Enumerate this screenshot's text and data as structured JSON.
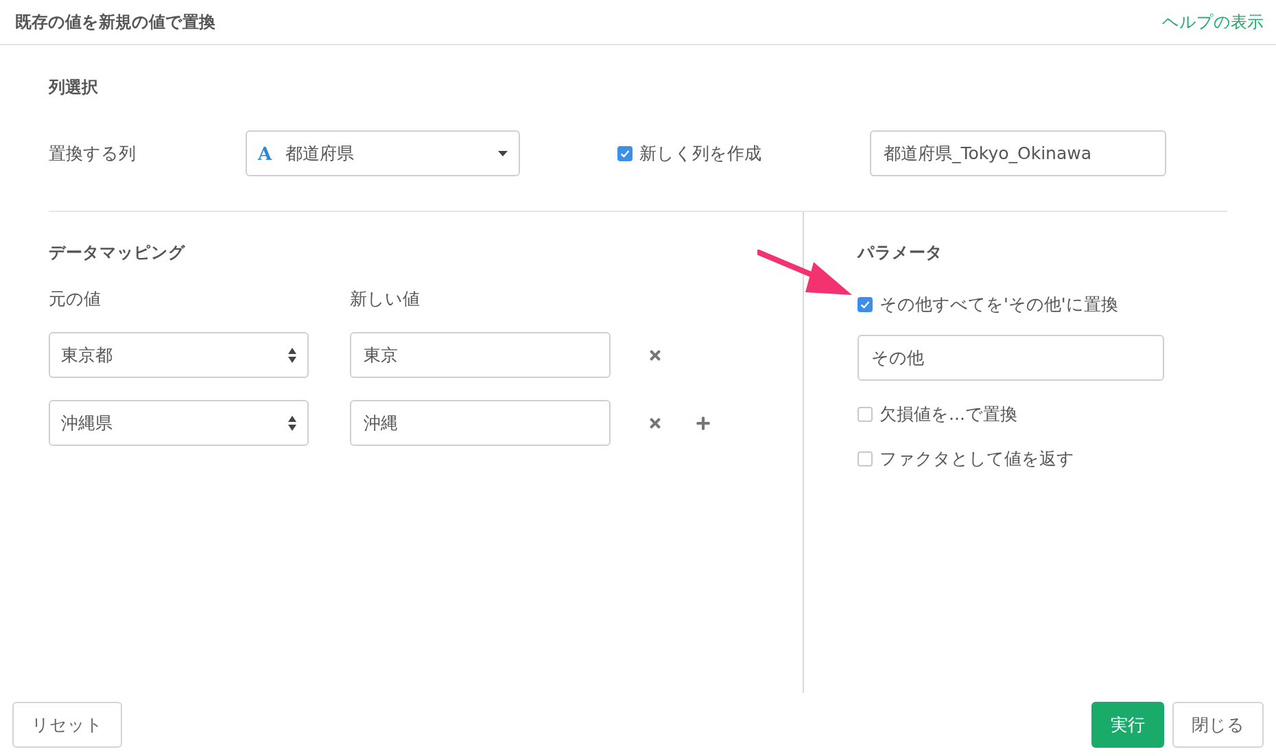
{
  "dialog": {
    "title": "既存の値を新規の値で置換",
    "help_link": "ヘルプの表示"
  },
  "column_selection": {
    "heading": "列選択",
    "label": "置換する列",
    "column_select": {
      "type_icon": "A",
      "value": "都道府県"
    },
    "new_column": {
      "label": "新しく列を作成",
      "checked": true
    },
    "new_column_name": {
      "value": "都道府県_Tokyo_Okinawa"
    }
  },
  "data_mapping": {
    "heading": "データマッピング",
    "original_label": "元の値",
    "new_label": "新しい値",
    "rows": [
      {
        "original": "東京都",
        "new": "東京"
      },
      {
        "original": "沖縄県",
        "new": "沖縄"
      }
    ]
  },
  "parameters": {
    "heading": "パラメータ",
    "options": [
      {
        "label": "その他すべてを'その他'に置換",
        "checked": true,
        "value": "その他"
      },
      {
        "label": "欠損値を...で置換",
        "checked": false
      },
      {
        "label": "ファクタとして値を返す",
        "checked": false
      }
    ]
  },
  "buttons": [
    {
      "label": "リセット",
      "kind": "secondary"
    },
    {
      "label": "実行",
      "kind": "primary"
    },
    {
      "label": "閉じる",
      "kind": "secondary"
    }
  ]
}
